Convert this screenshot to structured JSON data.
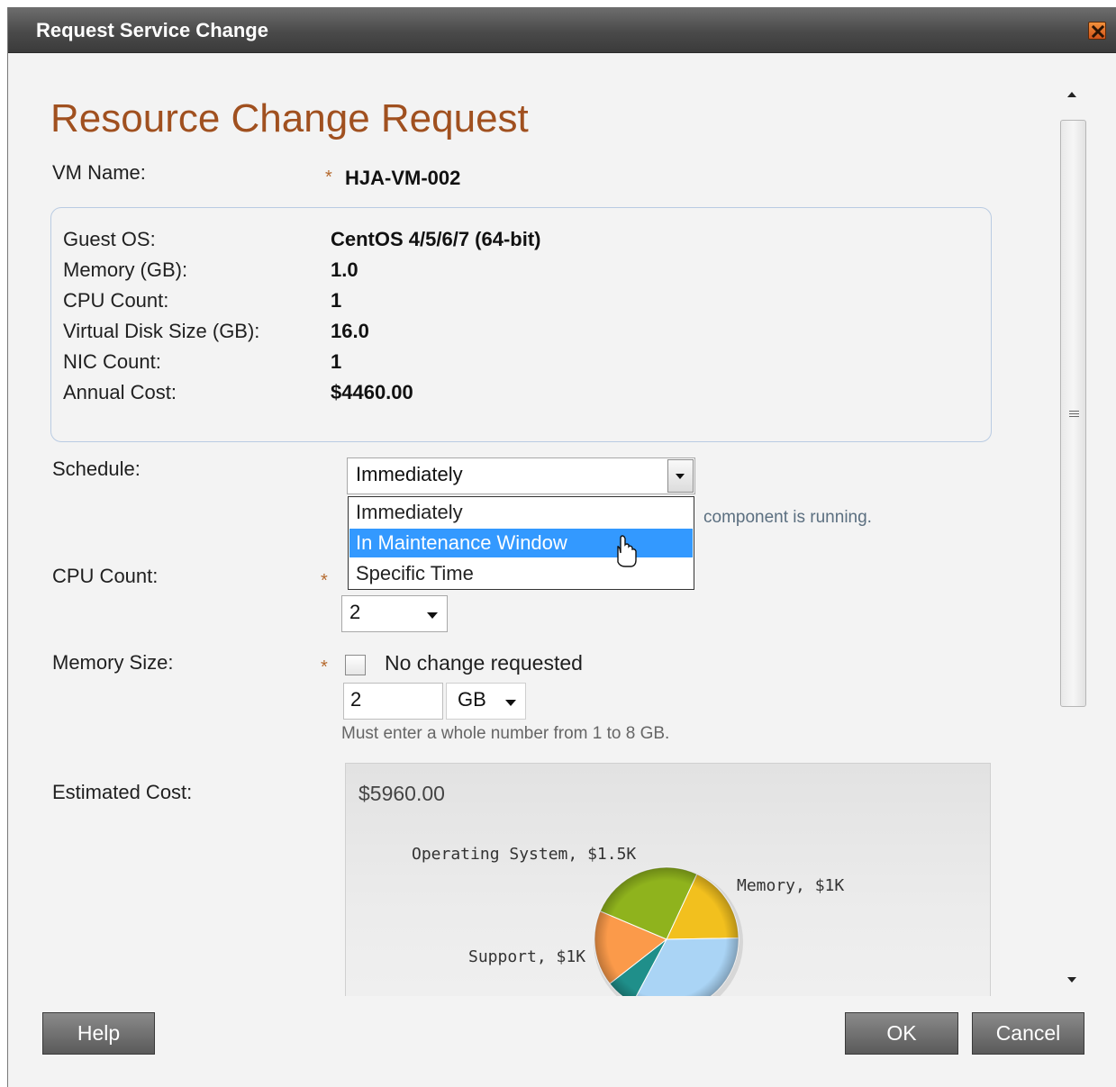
{
  "dialog": {
    "title": "Request Service Change"
  },
  "form": {
    "heading": "Resource Change Request",
    "vm_name_label": "VM Name:",
    "vm_name_required": "*",
    "vm_name_value": "HJA-VM-002",
    "info": {
      "guest_os_label": "Guest OS:",
      "guest_os_value": "CentOS 4/5/6/7 (64-bit)",
      "memory_label": "Memory (GB):",
      "memory_value": "1.0",
      "cpu_label": "CPU Count:",
      "cpu_value": "1",
      "disk_label": "Virtual Disk Size (GB):",
      "disk_value": "16.0",
      "nic_label": "NIC Count:",
      "nic_value": "1",
      "cost_label": "Annual Cost:",
      "cost_value": "$4460.00"
    },
    "schedule": {
      "label": "Schedule:",
      "selected": "Immediately",
      "options": [
        "Immediately",
        "In Maintenance Window",
        "Specific Time"
      ],
      "highlighted_index": 1,
      "hint_partial": "component is running."
    },
    "cpu": {
      "label": "CPU Count:",
      "required": "*",
      "value": "2"
    },
    "memory": {
      "label": "Memory Size:",
      "required": "*",
      "no_change_label": "No change requested",
      "no_change_checked": false,
      "value": "2",
      "unit": "GB",
      "note": "Must enter a whole number from 1 to 8 GB."
    },
    "estimate": {
      "label": "Estimated Cost:",
      "total": "$5960.00"
    }
  },
  "chart_data": {
    "type": "pie",
    "slices": [
      {
        "label": "Operating System, $1.5K",
        "value": 1.5,
        "color": "#8fb31d"
      },
      {
        "label": "Memory, $1K",
        "value": 1.0,
        "color": "#f2c01e"
      },
      {
        "label": "Support, $1K",
        "value": 1.0,
        "color": "#fb9a4a"
      }
    ],
    "partially_visible_colors": [
      "#aad4f5",
      "#1f8f8a"
    ]
  },
  "buttons": {
    "help": "Help",
    "ok": "OK",
    "cancel": "Cancel"
  },
  "colors": {
    "heading": "#a0501f",
    "selection": "#3399ff",
    "titlebar": "#4a4a4a"
  }
}
